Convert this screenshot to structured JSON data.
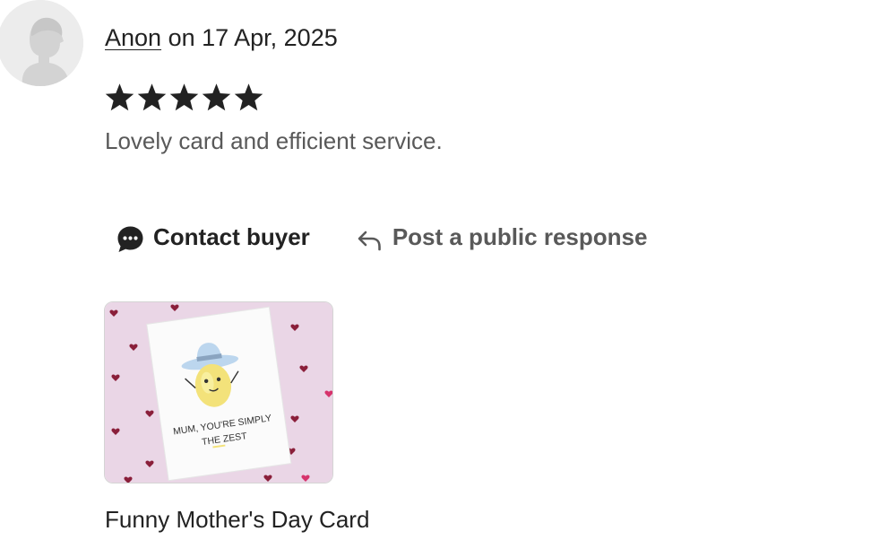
{
  "review": {
    "author": "Anon",
    "date_text": " on 17 Apr, 2025",
    "rating": 5,
    "rating_max": 5,
    "text": "Lovely card and efficient service."
  },
  "actions": {
    "contact_label": "Contact buyer",
    "respond_label": "Post a public response"
  },
  "product": {
    "title": "Funny Mother's Day Card",
    "card_text": [
      "MUM, YOU'RE SIMPLY",
      "THE ZEST"
    ]
  },
  "colors": {
    "text_primary": "#222222",
    "text_secondary": "#595959",
    "star": "#222222",
    "avatar_bg": "#ececec",
    "thumb_bg": "#ead6e6"
  },
  "icons": {
    "avatar": "default-avatar-silhouette",
    "star": "star-icon",
    "contact": "speech-bubble-icon",
    "respond": "reply-arrow-icon"
  }
}
